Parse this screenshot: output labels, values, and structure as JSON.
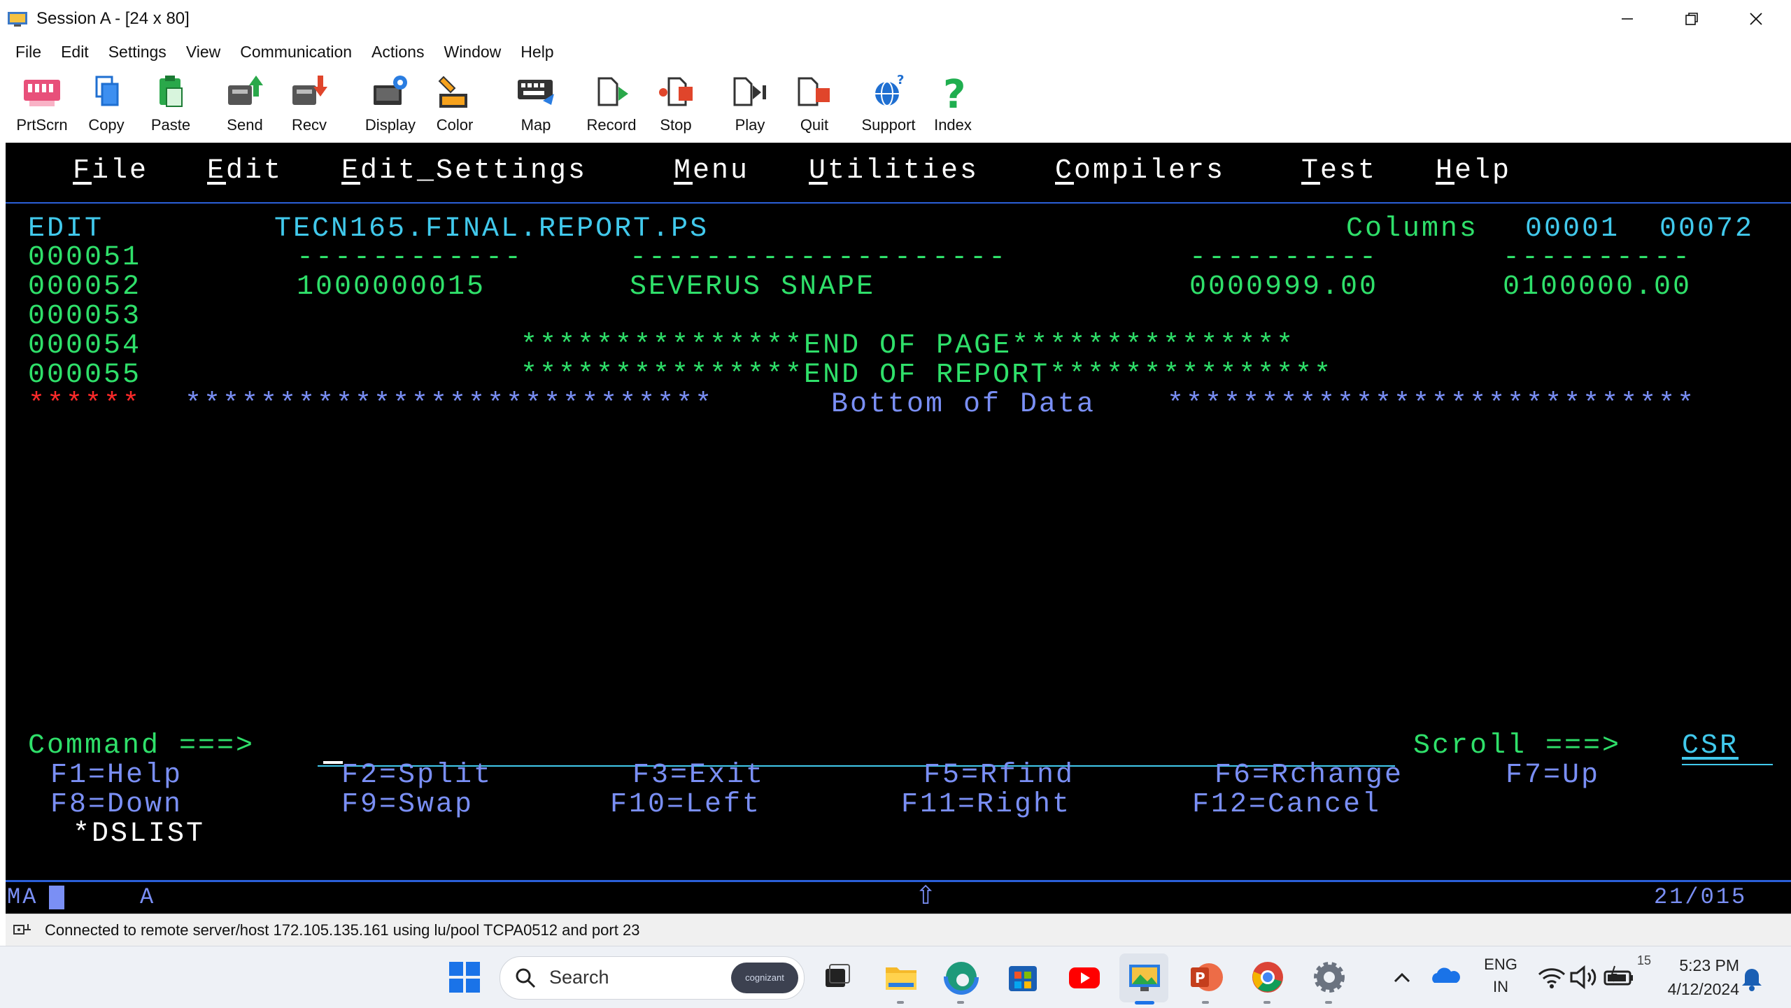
{
  "window": {
    "title": "Session A - [24 x 80]"
  },
  "menubar": [
    "File",
    "Edit",
    "Settings",
    "View",
    "Communication",
    "Actions",
    "Window",
    "Help"
  ],
  "toolbar": [
    {
      "label": "PrtScrn",
      "icon": "print-screen-icon"
    },
    {
      "label": "Copy",
      "icon": "copy-icon"
    },
    {
      "label": "Paste",
      "icon": "paste-icon"
    },
    {
      "label": "Send",
      "icon": "send-icon"
    },
    {
      "label": "Recv",
      "icon": "receive-icon"
    },
    {
      "label": "Display",
      "icon": "display-icon"
    },
    {
      "label": "Color",
      "icon": "color-icon"
    },
    {
      "label": "Map",
      "icon": "keyboard-map-icon"
    },
    {
      "label": "Record",
      "icon": "record-icon"
    },
    {
      "label": "Stop",
      "icon": "stop-icon"
    },
    {
      "label": "Play",
      "icon": "play-icon"
    },
    {
      "label": "Quit",
      "icon": "quit-icon"
    },
    {
      "label": "Support",
      "icon": "support-globe-icon"
    },
    {
      "label": "Index",
      "icon": "help-index-icon"
    }
  ],
  "terminal": {
    "menu": [
      "File",
      "Edit",
      "Edit_Settings",
      "Menu",
      "Utilities",
      "Compilers",
      "Test",
      "Help"
    ],
    "header": {
      "mode": "EDIT",
      "dataset": "TECN165.FINAL.REPORT.PS",
      "columns_label": "Columns",
      "col_from": "00001",
      "col_to": "00072"
    },
    "rows": [
      {
        "num": "000051",
        "fields": [
          "------------",
          "--------------------",
          "----------",
          "----------"
        ]
      },
      {
        "num": "000052",
        "fields": [
          "1000000015",
          "SEVERUS SNAPE",
          "0000999.00",
          "0100000.00"
        ]
      },
      {
        "num": "000053",
        "text": ""
      },
      {
        "num": "000054",
        "text": "***************END OF PAGE***************"
      },
      {
        "num": "000055",
        "text": "***************END OF REPORT***************"
      }
    ],
    "bottom": {
      "marker": "******",
      "left_stars": "****************************",
      "label": "Bottom of Data",
      "right_stars": "****************************"
    },
    "command": {
      "label": "Command ===>",
      "value": "",
      "scroll_label": "Scroll ===>",
      "scroll_value": "CSR"
    },
    "pfkeys_row1": [
      "F1=Help",
      "F2=Split",
      "F3=Exit",
      "F5=Rfind",
      "F6=Rchange",
      "F7=Up"
    ],
    "pfkeys_row2": [
      "F8=Down",
      "F9=Swap",
      "F10=Left",
      "F11=Right",
      "F12=Cancel"
    ],
    "dslist": "*DSLIST",
    "oia": {
      "left": "MA",
      "indicator": "A",
      "shift": "⇧",
      "cursor": "21/015"
    }
  },
  "connection_status": "Connected to remote server/host 172.105.135.161 using lu/pool TCPA0512 and port 23",
  "taskbar": {
    "search_placeholder": "Search",
    "search_badge": "cognizant",
    "language_top": "ENG",
    "language_bottom": "IN",
    "notif_count": "15",
    "time": "5:23 PM",
    "date": "4/12/2024"
  },
  "colors": {
    "terminal_bg": "#000000",
    "green": "#2fe06a",
    "turquoise": "#41c9ec",
    "blue": "#7a8ff5",
    "red": "#ff2a2a"
  }
}
